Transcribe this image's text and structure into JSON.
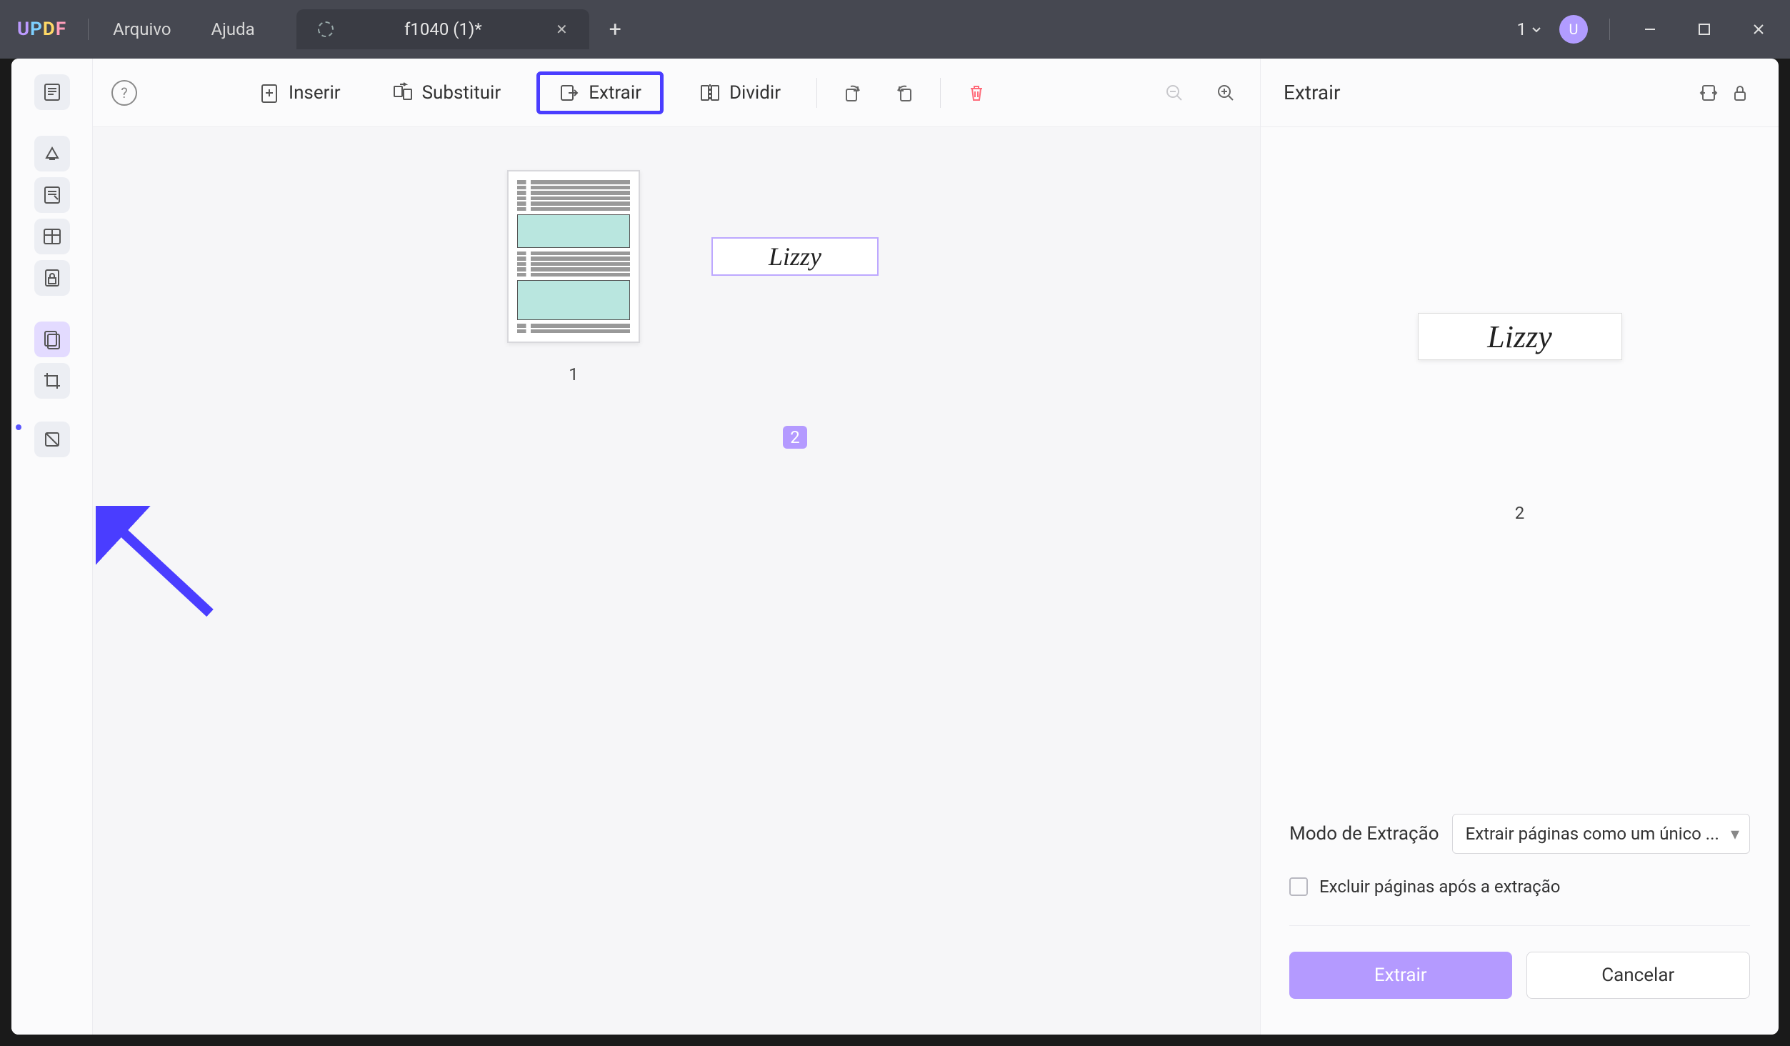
{
  "titlebar": {
    "logo": "UPDF",
    "menu": {
      "file": "Arquivo",
      "help": "Ajuda"
    },
    "tab": {
      "title": "f1040 (1)*"
    },
    "tab_count": "1",
    "avatar_initial": "U"
  },
  "toolbar": {
    "insert": "Inserir",
    "replace": "Substituir",
    "extract": "Extrair",
    "split": "Dividir"
  },
  "thumbs": {
    "page1_num": "1",
    "page2_num": "2",
    "page2_text": "Lizzy"
  },
  "right_panel": {
    "title": "Extrair",
    "preview_text": "Lizzy",
    "preview_num": "2",
    "mode_label": "Modo de Extração",
    "mode_value": "Extrair páginas como um único ...",
    "delete_after_label": "Excluir páginas após a extração",
    "extract_btn": "Extrair",
    "cancel_btn": "Cancelar"
  }
}
